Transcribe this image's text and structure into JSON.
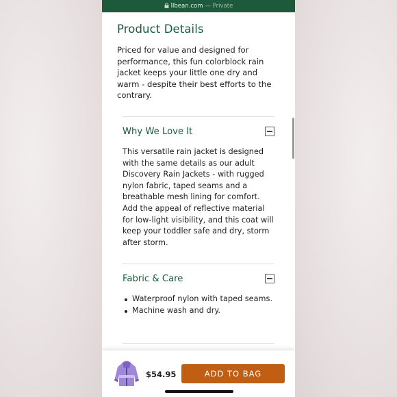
{
  "browser": {
    "host": "llbean.com",
    "mode": "— Private",
    "lock_icon": "lock-icon"
  },
  "page": {
    "title": "Product Details",
    "intro": "Priced for value and designed for performance, this fun colorblock rain jacket keeps your little one dry and warm - despite their best efforts to the contrary."
  },
  "sections": [
    {
      "title": "Why We Love It",
      "state": "expanded",
      "text": "This versatile rain jacket is designed with the same details as our adult Discovery Rain Jackets - with rugged nylon fabric, taped seams and a breathable mesh lining for comfort. Add the appeal of reflective material for low-light visibility, and this coat will keep your toddler safe and dry, storm after storm."
    },
    {
      "title": "Fabric & Care",
      "state": "expanded",
      "bullets": [
        "Waterproof nylon with taped seams.",
        "Machine wash and dry."
      ]
    }
  ],
  "purchase": {
    "price": "$54.95",
    "button_label": "ADD TO BAG"
  },
  "colors": {
    "brand_green": "#1c5a3c",
    "url_bar": "#1d5a3c",
    "cta_orange": "#c05f14"
  }
}
